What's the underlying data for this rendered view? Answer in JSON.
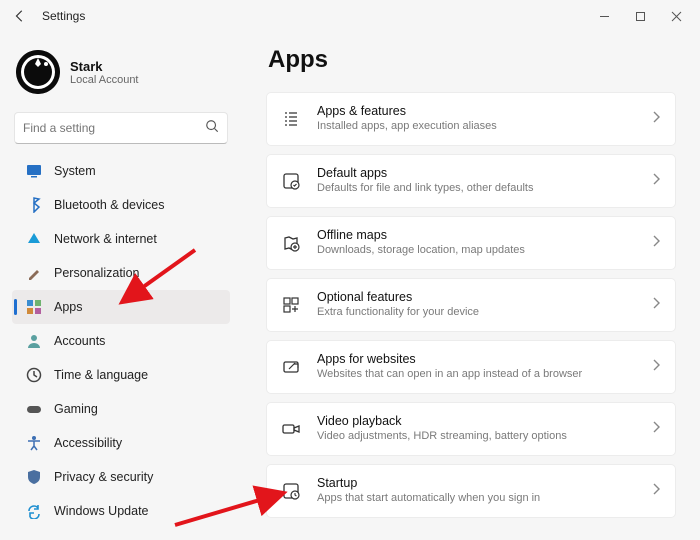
{
  "window": {
    "title": "Settings"
  },
  "profile": {
    "name": "Stark",
    "subtitle": "Local Account"
  },
  "search": {
    "placeholder": "Find a setting"
  },
  "sidebar": {
    "items": [
      {
        "id": "system",
        "label": "System",
        "icon": "system",
        "color": "#2670c4",
        "selected": false
      },
      {
        "id": "bluetooth",
        "label": "Bluetooth & devices",
        "icon": "bluetooth",
        "color": "#2670c4",
        "selected": false
      },
      {
        "id": "network",
        "label": "Network & internet",
        "icon": "network",
        "color": "#1a9bd7",
        "selected": false
      },
      {
        "id": "personalization",
        "label": "Personalization",
        "icon": "personalization",
        "color": "#8a6b57",
        "selected": false
      },
      {
        "id": "apps",
        "label": "Apps",
        "icon": "apps",
        "color": "#2f78c1",
        "selected": true
      },
      {
        "id": "accounts",
        "label": "Accounts",
        "icon": "accounts",
        "color": "#5aa0a0",
        "selected": false
      },
      {
        "id": "time",
        "label": "Time & language",
        "icon": "time",
        "color": "#444",
        "selected": false
      },
      {
        "id": "gaming",
        "label": "Gaming",
        "icon": "gaming",
        "color": "#555",
        "selected": false
      },
      {
        "id": "accessibility",
        "label": "Accessibility",
        "icon": "accessibility",
        "color": "#3d6fb3",
        "selected": false
      },
      {
        "id": "privacy",
        "label": "Privacy & security",
        "icon": "privacy",
        "color": "#4a6fa0",
        "selected": false
      },
      {
        "id": "update",
        "label": "Windows Update",
        "icon": "update",
        "color": "#1f8fd0",
        "selected": false
      }
    ]
  },
  "page": {
    "title": "Apps"
  },
  "cards": [
    {
      "id": "apps-features",
      "title": "Apps & features",
      "subtitle": "Installed apps, app execution aliases",
      "icon": "list"
    },
    {
      "id": "default-apps",
      "title": "Default apps",
      "subtitle": "Defaults for file and link types, other defaults",
      "icon": "default"
    },
    {
      "id": "offline-maps",
      "title": "Offline maps",
      "subtitle": "Downloads, storage location, map updates",
      "icon": "map"
    },
    {
      "id": "optional-features",
      "title": "Optional features",
      "subtitle": "Extra functionality for your device",
      "icon": "plus"
    },
    {
      "id": "apps-websites",
      "title": "Apps for websites",
      "subtitle": "Websites that can open in an app instead of a browser",
      "icon": "link"
    },
    {
      "id": "video-playback",
      "title": "Video playback",
      "subtitle": "Video adjustments, HDR streaming, battery options",
      "icon": "video"
    },
    {
      "id": "startup",
      "title": "Startup",
      "subtitle": "Apps that start automatically when you sign in",
      "icon": "startup"
    }
  ],
  "annotations": {
    "arrow_color": "#e2151b",
    "arrow1_target": "sidebar-apps",
    "arrow2_target": "card-startup"
  }
}
